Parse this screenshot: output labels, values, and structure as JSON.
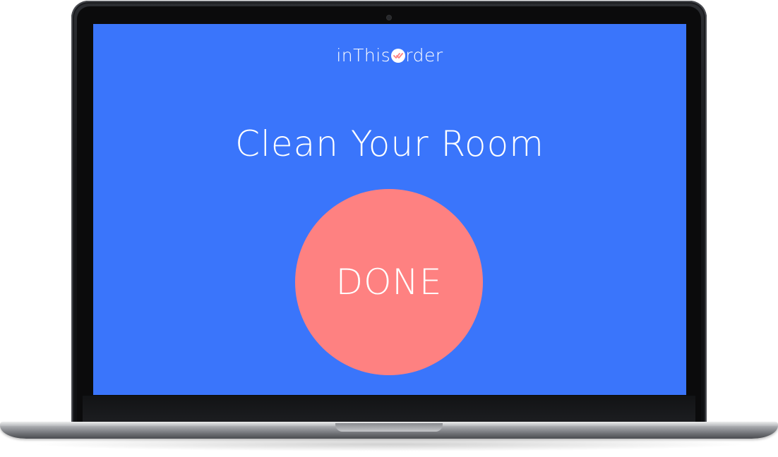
{
  "app": {
    "logo_prefix": "inThis",
    "logo_suffix": "rder",
    "logo_mark_icon": "check-circle-icon"
  },
  "task": {
    "title": "Clean Your Room"
  },
  "actions": {
    "done_label": "DONE"
  },
  "colors": {
    "screen_background": "#3a75fb",
    "done_button": "#fe8181",
    "text": "#ffffff",
    "logo_check": "#fe8181"
  }
}
